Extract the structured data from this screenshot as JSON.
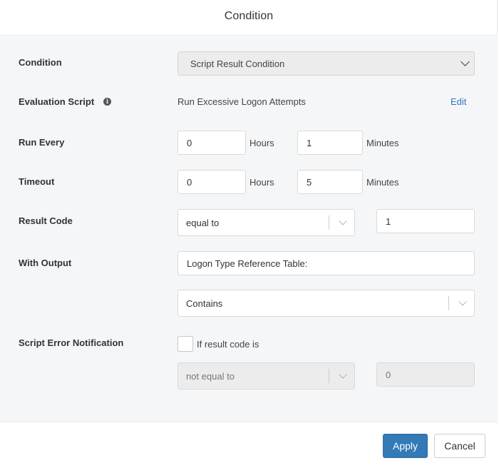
{
  "dialog": {
    "title": "Condition"
  },
  "condition": {
    "label": "Condition",
    "value": "Script Result Condition"
  },
  "evaluation_script": {
    "label": "Evaluation Script",
    "value": "Run Excessive Logon Attempts",
    "edit_label": "Edit",
    "info_glyph": "i"
  },
  "run_every": {
    "label": "Run Every",
    "hours_value": "0",
    "hours_unit": "Hours",
    "minutes_value": "1",
    "minutes_unit": "Minutes"
  },
  "timeout": {
    "label": "Timeout",
    "hours_value": "0",
    "hours_unit": "Hours",
    "minutes_value": "5",
    "minutes_unit": "Minutes"
  },
  "result_code": {
    "label": "Result Code",
    "operator": "equal to",
    "value": "1"
  },
  "with_output": {
    "label": "With Output",
    "text_value": "Logon Type Reference Table:",
    "match_operator": "Contains"
  },
  "script_error": {
    "label": "Script Error Notification",
    "checkbox_label": "If result code is",
    "operator": "not equal to",
    "value": "0"
  },
  "footer": {
    "apply_label": "Apply",
    "cancel_label": "Cancel"
  },
  "colors": {
    "primary": "#337ab7",
    "link": "#2f77c0",
    "body_background": "#f5f6f8"
  }
}
